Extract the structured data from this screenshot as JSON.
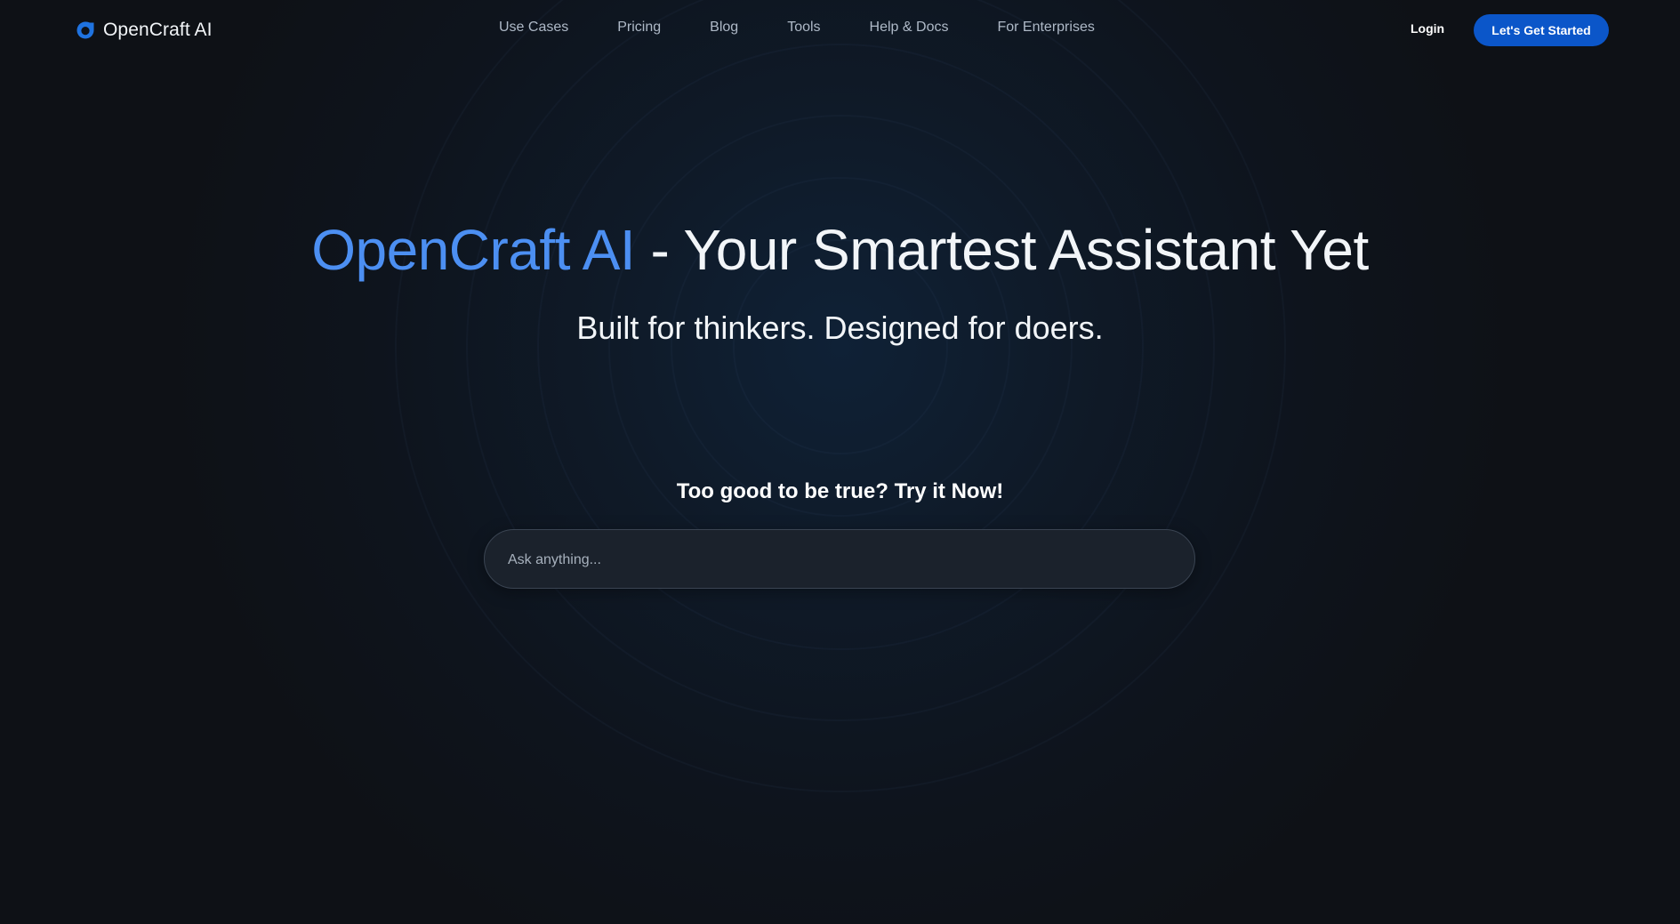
{
  "header": {
    "brand_name": "OpenCraft AI",
    "nav": [
      {
        "label": "Use Cases"
      },
      {
        "label": "Pricing"
      },
      {
        "label": "Blog"
      },
      {
        "label": "Tools"
      },
      {
        "label": "Help & Docs"
      },
      {
        "label": "For Enterprises"
      }
    ],
    "login_label": "Login",
    "cta_label": "Let's Get Started"
  },
  "hero": {
    "title_brand": "OpenCraft AI",
    "title_rest": " - Your Smartest Assistant Yet",
    "subtitle": "Built for thinkers. Designed for doers.",
    "prompt": "Too good to be true? Try it Now!",
    "input_placeholder": "Ask anything..."
  },
  "colors": {
    "background": "#0e1116",
    "accent": "#4c8ff2",
    "cta_background": "#0b56c9",
    "input_background": "#1b222c"
  },
  "icons": {
    "brand_logo": "opencraft-logo-icon"
  }
}
